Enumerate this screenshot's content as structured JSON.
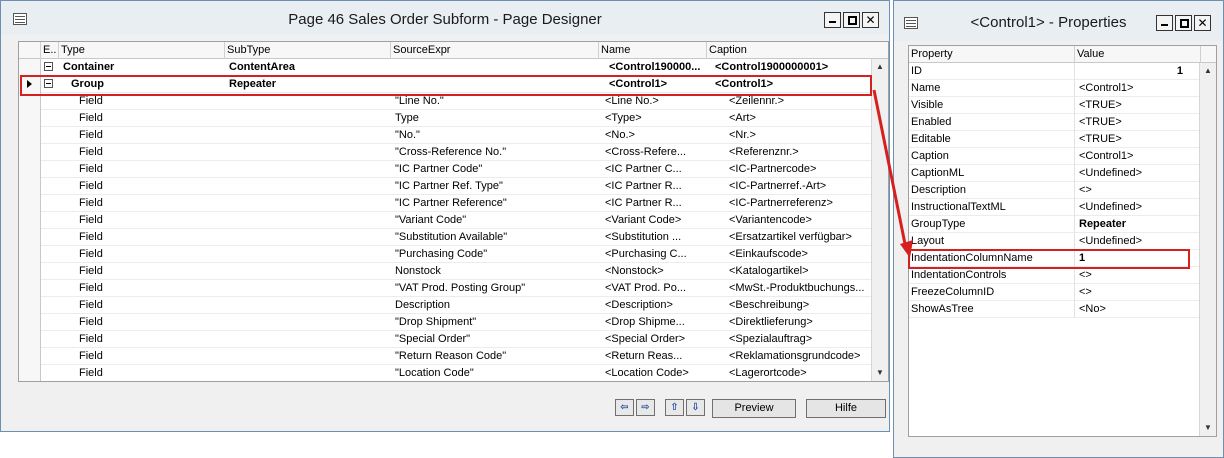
{
  "designer": {
    "title": "Page 46 Sales Order Subform - Page Designer",
    "columns": [
      "E..",
      "Type",
      "SubType",
      "SourceExpr",
      "Name",
      "Caption"
    ],
    "rows": [
      {
        "type": "Container",
        "subtype": "ContentArea",
        "source": "",
        "name": "<Control190000...",
        "caption": "<Control1900000001>",
        "level": 0,
        "bold": true,
        "expander": true
      },
      {
        "type": "Group",
        "subtype": "Repeater",
        "source": "",
        "name": "<Control1>",
        "caption": "<Control1>",
        "level": 1,
        "bold": true,
        "expander": true,
        "current": true
      },
      {
        "type": "Field",
        "subtype": "",
        "source": "\"Line No.\"",
        "name": "<Line No.>",
        "caption": "<Zeilennr.>",
        "level": 2
      },
      {
        "type": "Field",
        "subtype": "",
        "source": "Type",
        "name": "<Type>",
        "caption": "<Art>",
        "level": 2
      },
      {
        "type": "Field",
        "subtype": "",
        "source": "\"No.\"",
        "name": "<No.>",
        "caption": "<Nr.>",
        "level": 2
      },
      {
        "type": "Field",
        "subtype": "",
        "source": "\"Cross-Reference No.\"",
        "name": "<Cross-Refere...",
        "caption": "<Referenznr.>",
        "level": 2
      },
      {
        "type": "Field",
        "subtype": "",
        "source": "\"IC Partner Code\"",
        "name": "<IC Partner C...",
        "caption": "<IC-Partnercode>",
        "level": 2
      },
      {
        "type": "Field",
        "subtype": "",
        "source": "\"IC Partner Ref. Type\"",
        "name": "<IC Partner R...",
        "caption": "<IC-Partnerref.-Art>",
        "level": 2
      },
      {
        "type": "Field",
        "subtype": "",
        "source": "\"IC Partner Reference\"",
        "name": "<IC Partner R...",
        "caption": "<IC-Partnerreferenz>",
        "level": 2
      },
      {
        "type": "Field",
        "subtype": "",
        "source": "\"Variant Code\"",
        "name": "<Variant Code>",
        "caption": "<Variantencode>",
        "level": 2
      },
      {
        "type": "Field",
        "subtype": "",
        "source": "\"Substitution Available\"",
        "name": "<Substitution ...",
        "caption": "<Ersatzartikel verfügbar>",
        "level": 2
      },
      {
        "type": "Field",
        "subtype": "",
        "source": "\"Purchasing Code\"",
        "name": "<Purchasing C...",
        "caption": "<Einkaufscode>",
        "level": 2
      },
      {
        "type": "Field",
        "subtype": "",
        "source": "Nonstock",
        "name": "<Nonstock>",
        "caption": "<Katalogartikel>",
        "level": 2
      },
      {
        "type": "Field",
        "subtype": "",
        "source": "\"VAT Prod. Posting Group\"",
        "name": "<VAT Prod. Po...",
        "caption": "<MwSt.-Produktbuchungs...",
        "level": 2
      },
      {
        "type": "Field",
        "subtype": "",
        "source": "Description",
        "name": "<Description>",
        "caption": "<Beschreibung>",
        "level": 2
      },
      {
        "type": "Field",
        "subtype": "",
        "source": "\"Drop Shipment\"",
        "name": "<Drop Shipme...",
        "caption": "<Direktlieferung>",
        "level": 2
      },
      {
        "type": "Field",
        "subtype": "",
        "source": "\"Special Order\"",
        "name": "<Special Order>",
        "caption": "<Spezialauftrag>",
        "level": 2
      },
      {
        "type": "Field",
        "subtype": "",
        "source": "\"Return Reason Code\"",
        "name": "<Return Reas...",
        "caption": "<Reklamationsgrundcode>",
        "level": 2
      },
      {
        "type": "Field",
        "subtype": "",
        "source": "\"Location Code\"",
        "name": "<Location Code>",
        "caption": "<Lagerortcode>",
        "level": 2
      }
    ],
    "buttons": {
      "preview": "Preview",
      "help": "Hilfe"
    }
  },
  "properties": {
    "title": "<Control1> - Properties",
    "columns": [
      "Property",
      "Value"
    ],
    "rows": [
      {
        "property": "ID",
        "value": "1",
        "align": "right"
      },
      {
        "property": "Name",
        "value": "<Control1>"
      },
      {
        "property": "Visible",
        "value": "<TRUE>"
      },
      {
        "property": "Enabled",
        "value": "<TRUE>"
      },
      {
        "property": "Editable",
        "value": "<TRUE>"
      },
      {
        "property": "Caption",
        "value": "<Control1>"
      },
      {
        "property": "CaptionML",
        "value": "<Undefined>"
      },
      {
        "property": "Description",
        "value": "<>"
      },
      {
        "property": "InstructionalTextML",
        "value": "<Undefined>"
      },
      {
        "property": "GroupType",
        "value": "Repeater",
        "bold": true
      },
      {
        "property": "Layout",
        "value": "<Undefined>"
      },
      {
        "property": "IndentationColumnName",
        "value": "1",
        "bold": true,
        "highlight": true
      },
      {
        "property": "IndentationControls",
        "value": "<>"
      },
      {
        "property": "FreezeColumnID",
        "value": "<>"
      },
      {
        "property": "ShowAsTree",
        "value": "<No>"
      }
    ]
  },
  "colors": {
    "accent_red": "#d52020"
  }
}
